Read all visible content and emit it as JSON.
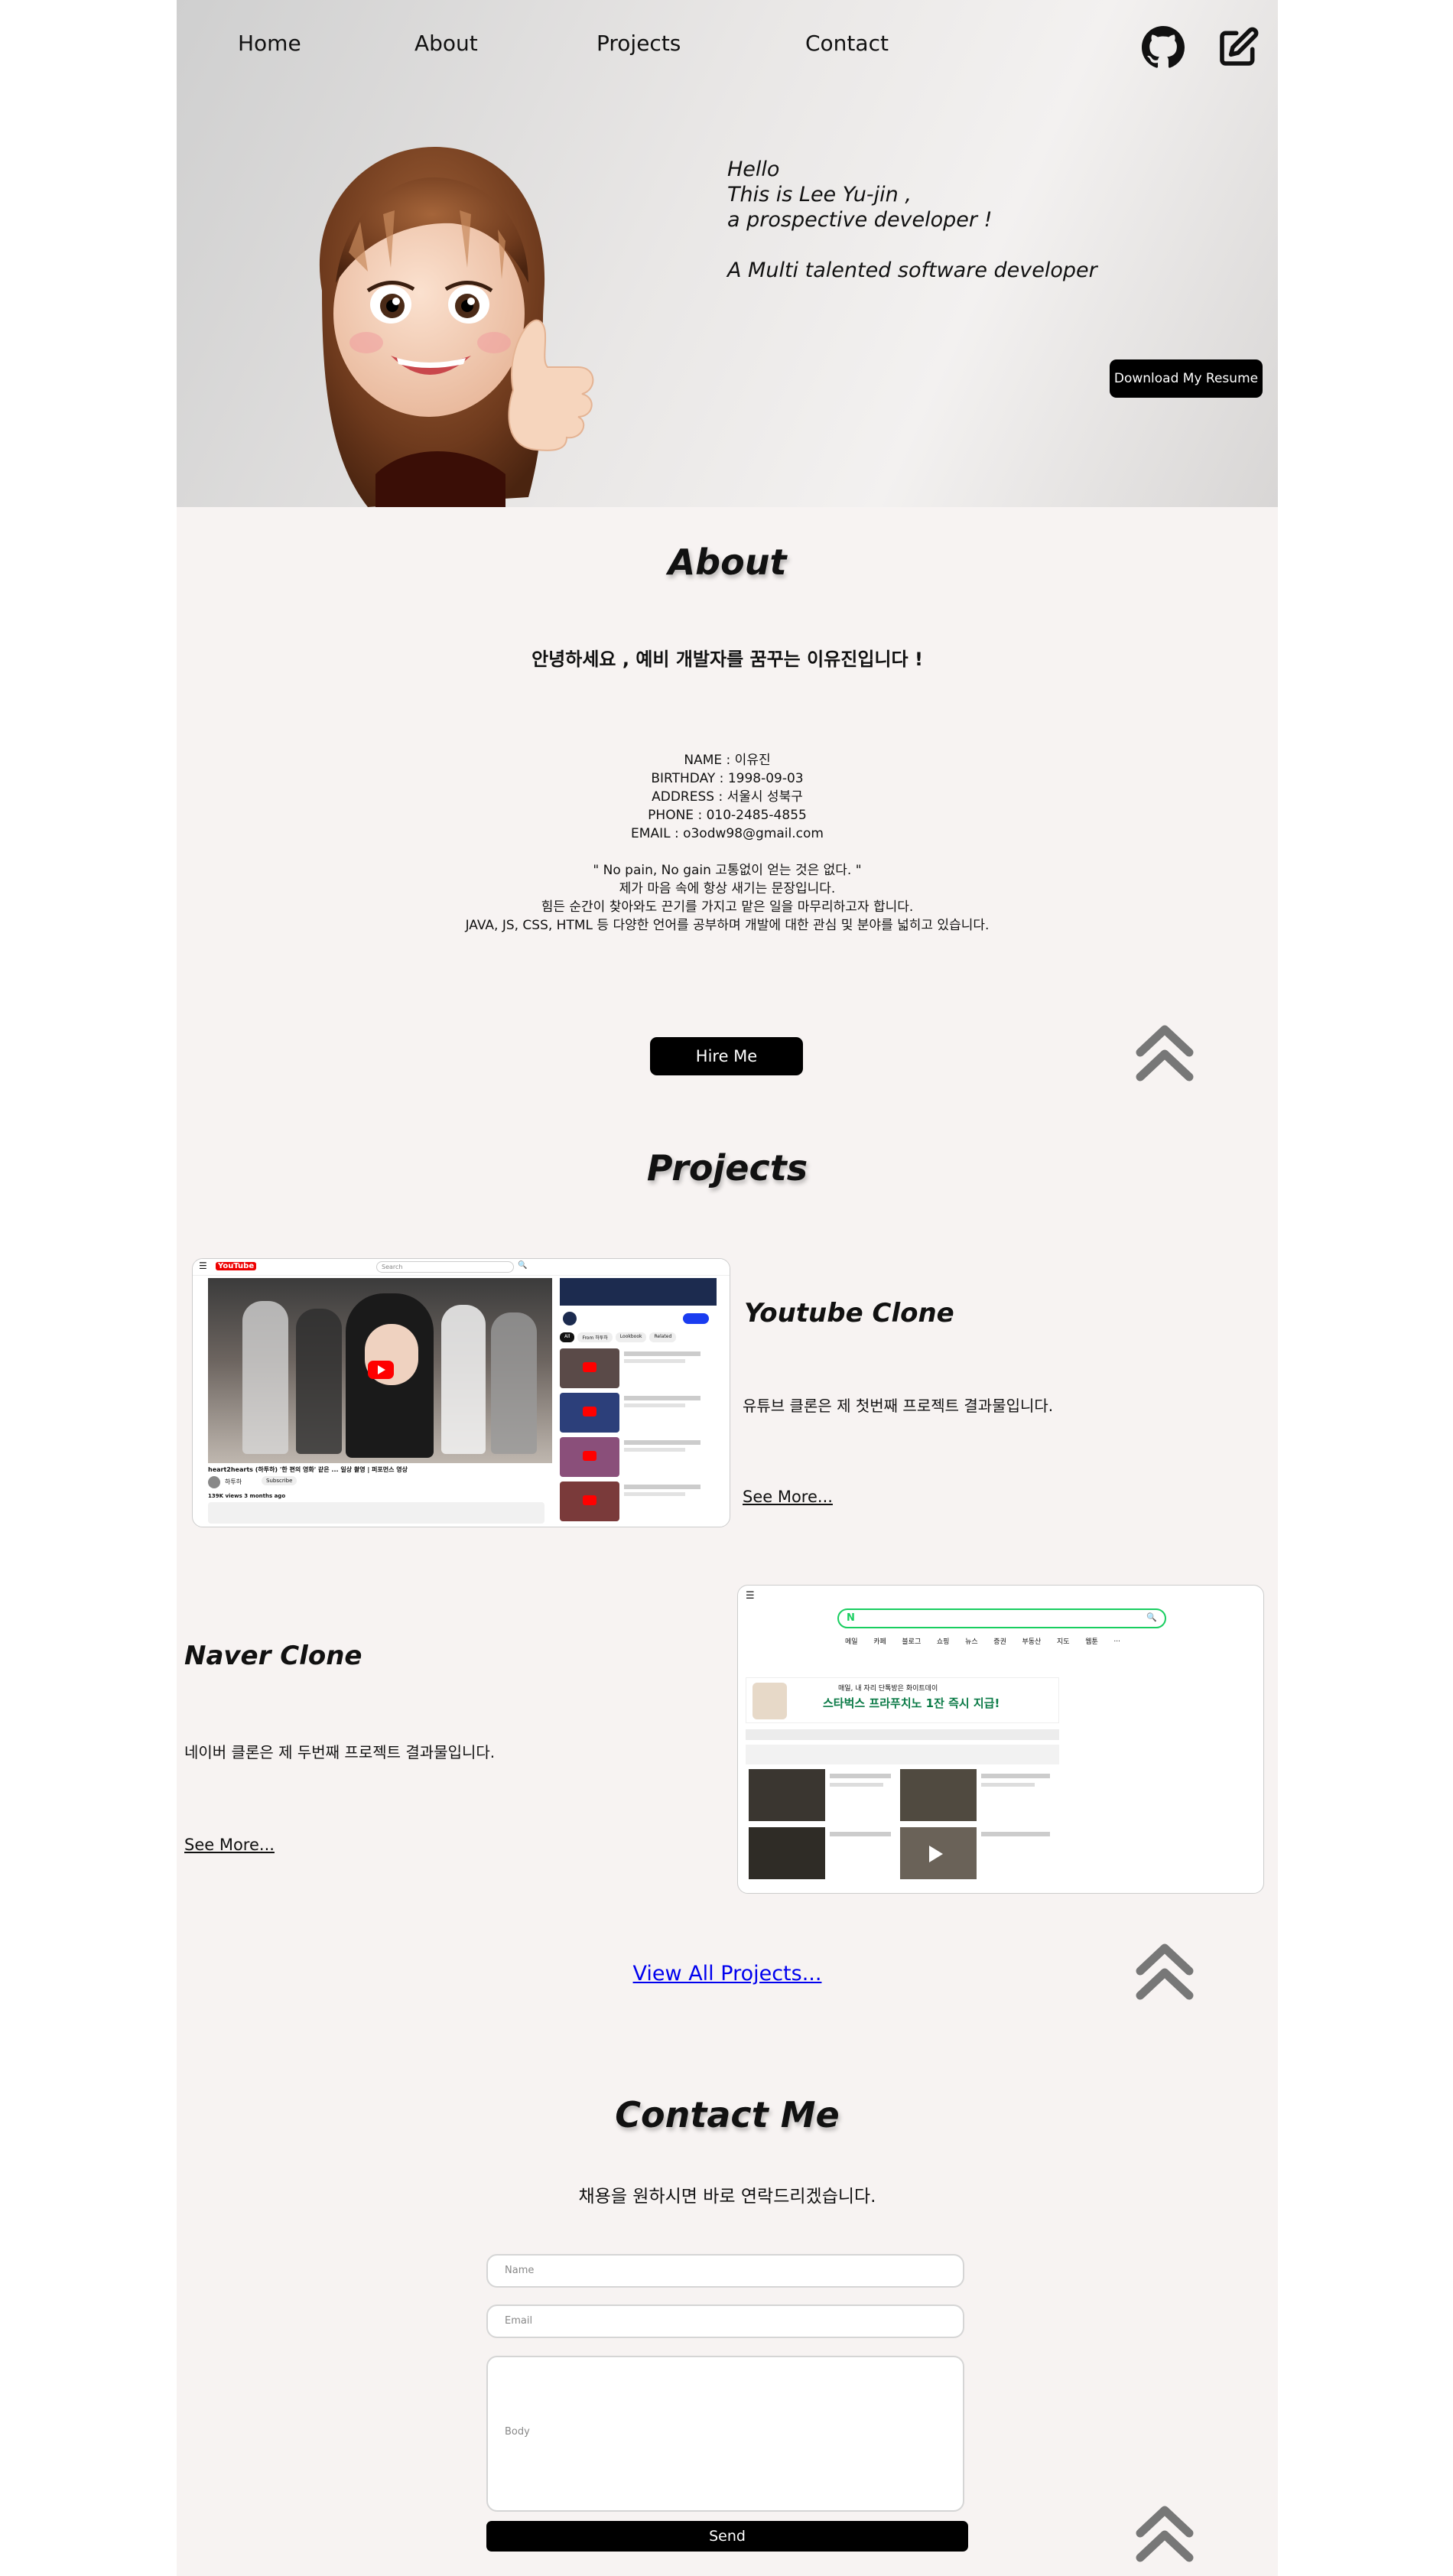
{
  "nav": {
    "home": "Home",
    "about": "About",
    "projects": "Projects",
    "contact": "Contact",
    "icons": [
      "github-icon",
      "edit-icon"
    ]
  },
  "hero": {
    "line1": "Hello",
    "line2": "This is Lee Yu-jin ,",
    "line3": "a prospective developer !",
    "line4": "A Multi talented software developer",
    "resume_button": "Download My Resume"
  },
  "about": {
    "title": "About",
    "greeting": "안녕하세요 , 예비 개발자를 꿈꾸는 이유진입니다 !",
    "name": "NAME : 이유진",
    "birthday": "BIRTHDAY : 1998-09-03",
    "address": "ADDRESS : 서울시 성북구",
    "phone": "PHONE : 010-2485-4855",
    "email": "EMAIL : o3odw98@gmail.com",
    "quote": "\" No pain, No gain 고통없이 얻는 것은 없다. \"",
    "motto1": "제가 마음 속에 항상 새기는 문장입니다.",
    "motto2": "힘든 순간이 찾아와도 끈기를 가지고 맡은 일을 마무리하고자 합니다.",
    "motto3": "JAVA, JS, CSS, HTML 등 다양한 언어를 공부하며 개발에 대한 관심 및 분야를 넓히고 있습니다.",
    "hire_button": "Hire Me"
  },
  "projects": {
    "title": "Projects",
    "items": [
      {
        "title": "Youtube Clone",
        "desc": "유튜브 클론은 제 첫번째 프로젝트 결과물입니다.",
        "more": "See More..."
      },
      {
        "title": "Naver Clone",
        "desc": "네이버 클론은 제 두번째 프로젝트 결과물입니다.",
        "more": "See More..."
      }
    ],
    "view_all": "View All Projects..."
  },
  "youtube_preview": {
    "logo": "YouTube",
    "search": "Search",
    "video_title": "heart2hearts (하투하) '한 편의 영화' 같은 ... 일상 촬영 | 퍼포먼스 영상",
    "channel": "하투하",
    "subscribe": "Subscribe",
    "views": "139K views 3 months ago",
    "chips": [
      "All",
      "From 하투하",
      "Lookbook",
      "Related"
    ]
  },
  "naver_preview": {
    "logo": "N",
    "menu": [
      "메일",
      "카페",
      "블로그",
      "쇼핑",
      "뉴스",
      "증권",
      "부동산",
      "지도",
      "웹툰",
      "..."
    ],
    "banner": "스타벅스 프라푸치노 1잔 즉시 지급!",
    "banner_sub": "매일, 내 자리 단톡방은 화이트데이"
  },
  "contact": {
    "title": "Contact Me",
    "subtitle": "채용을 원하시면 바로 연락드리겠습니다.",
    "name_placeholder": "Name",
    "email_placeholder": "Email",
    "body_placeholder": "Body",
    "send_button": "Send"
  }
}
